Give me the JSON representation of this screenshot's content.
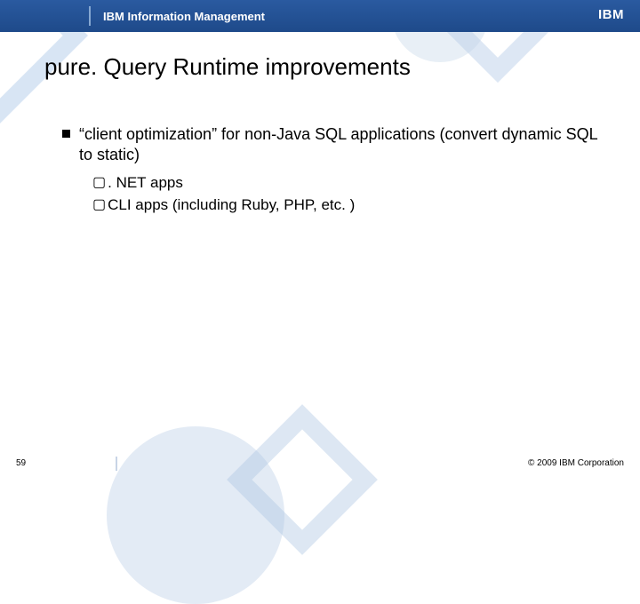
{
  "header": {
    "title": "IBM Information Management",
    "logo_text": "IBM"
  },
  "slide": {
    "title": "pure. Query Runtime improvements"
  },
  "bullets": {
    "main": "“client optimization” for non-Java SQL applications (convert dynamic SQL to static)",
    "sub1": ". NET apps",
    "sub2": "CLI apps (including Ruby, PHP, etc. )"
  },
  "footer": {
    "page": "59",
    "copyright": "© 2009 IBM Corporation"
  }
}
